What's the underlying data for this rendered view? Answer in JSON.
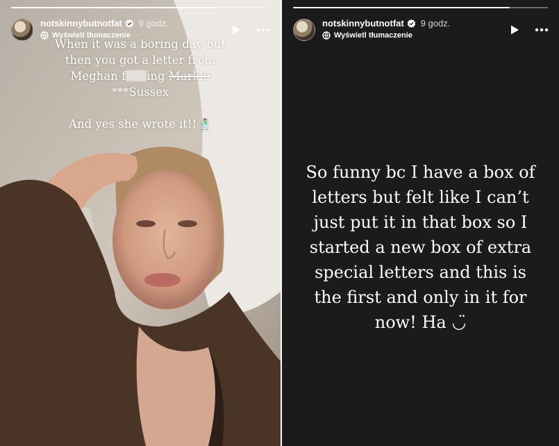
{
  "colors": {
    "story_text": "#ffffff",
    "left_background": "#c9c0b6",
    "right_background": "#1b1b1b",
    "verified_badge": "#ffffff",
    "emoji": "#7b3fa0"
  },
  "left_story": {
    "progress": 0.8,
    "header": {
      "username": "notskinnybutnotfat",
      "time": "9 godz.",
      "translate_label": "Wyświetl tłumaczenie",
      "icons": [
        "verified-badge-icon",
        "translate-icon",
        "play-icon",
        "more-icon"
      ]
    },
    "caption": {
      "line1": "When it was a boring day but",
      "line2": "then you got a letter from",
      "line3_prefix": "Meghan f",
      "line3_mid": "ing ",
      "line3_strike": "Markle",
      "line4": "***Sussex",
      "line5": "And yes she wrote it!!",
      "emoji": "🕺"
    }
  },
  "right_story": {
    "progress": 0.85,
    "header": {
      "username": "notskinnybutnotfat",
      "time": "9 godz.",
      "translate_label": "Wyświetl tłumaczenie",
      "icons": [
        "verified-badge-icon",
        "translate-icon",
        "play-icon",
        "more-icon"
      ]
    },
    "text_lines": [
      "So funny bc I have a box of",
      "letters but felt like I can’t",
      "just put it in that box so I",
      "started a new box of extra",
      "special letters and this is",
      "the first and only in it for",
      "now! Ha ◡̈"
    ]
  }
}
